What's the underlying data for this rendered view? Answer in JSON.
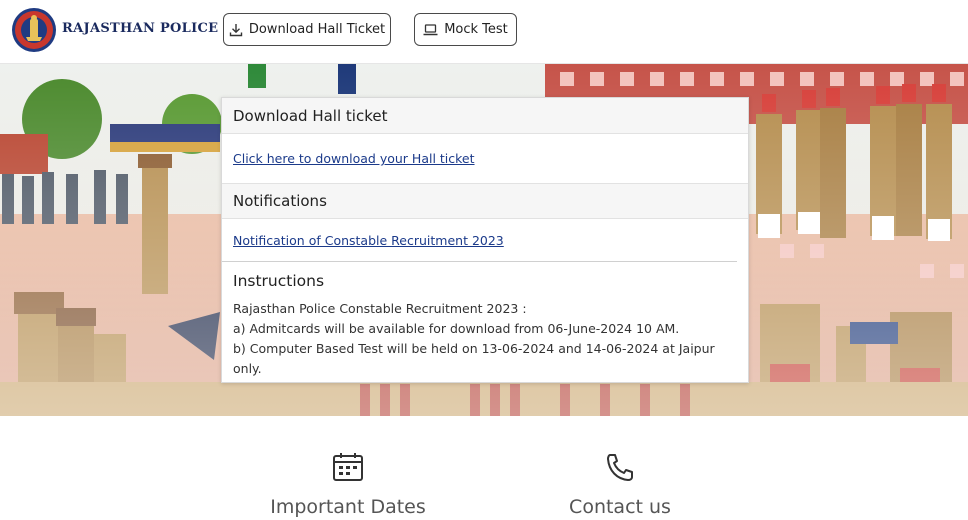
{
  "header": {
    "brand": "RAJASTHAN POLICE",
    "download_hall_ticket_label": "Download Hall Ticket",
    "mock_test_label": "Mock Test"
  },
  "hall_ticket": {
    "heading": "Download Hall ticket",
    "link_text": "Click here to download your Hall ticket"
  },
  "notifications": {
    "heading": "Notifications",
    "link_text": "Notification of Constable Recruitment 2023"
  },
  "instructions": {
    "heading": "Instructions",
    "lines": [
      "Rajasthan Police Constable Recruitment 2023 :",
      "a) Admitcards will be available for download from 06-June-2024 10 AM.",
      "b) Computer Based Test will be held on 13-06-2024 and 14-06-2024 at Jaipur only."
    ]
  },
  "features": {
    "important_dates": "Important Dates",
    "contact_us": "Contact us"
  },
  "colors": {
    "brand_text": "#1a2a5e",
    "link": "#1b3a8a",
    "khaki": "#b58d4e",
    "brick_red": "#c6544a"
  }
}
